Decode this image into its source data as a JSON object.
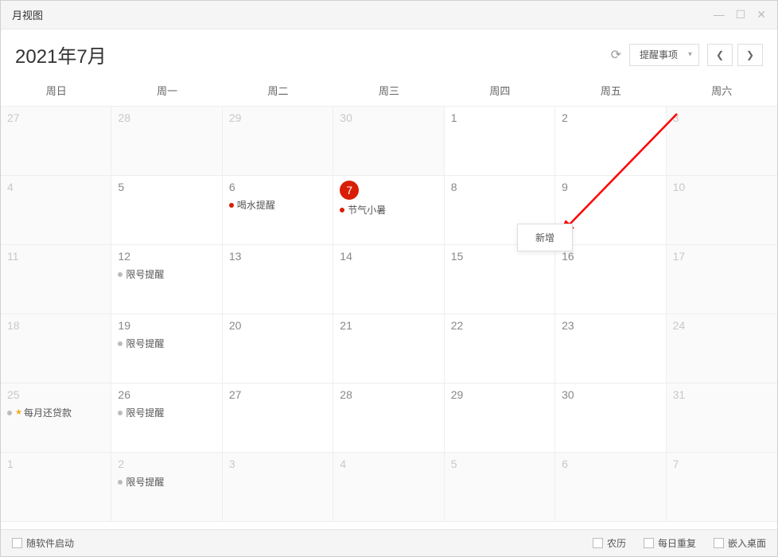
{
  "window": {
    "title": "月视图"
  },
  "header": {
    "month": "2021年7月",
    "filter": "提醒事项"
  },
  "weekdays": [
    "周日",
    "周一",
    "周二",
    "周三",
    "周四",
    "周五",
    "周六"
  ],
  "cells": [
    {
      "n": "27",
      "out": true,
      "events": []
    },
    {
      "n": "28",
      "out": true,
      "events": []
    },
    {
      "n": "29",
      "out": true,
      "events": []
    },
    {
      "n": "30",
      "out": true,
      "events": []
    },
    {
      "n": "1",
      "events": []
    },
    {
      "n": "2",
      "events": []
    },
    {
      "n": "3",
      "out": true,
      "events": []
    },
    {
      "n": "4",
      "out": true,
      "events": []
    },
    {
      "n": "5",
      "events": []
    },
    {
      "n": "6",
      "events": [
        {
          "dot": "red",
          "label": "喝水提醒"
        }
      ]
    },
    {
      "n": "7",
      "today": true,
      "events": [
        {
          "dot": "red",
          "label": "节气小暑"
        }
      ]
    },
    {
      "n": "8",
      "events": []
    },
    {
      "n": "9",
      "events": []
    },
    {
      "n": "10",
      "out": true,
      "events": []
    },
    {
      "n": "11",
      "out": true,
      "events": []
    },
    {
      "n": "12",
      "events": [
        {
          "dot": "gray",
          "label": "限号提醒"
        }
      ]
    },
    {
      "n": "13",
      "events": []
    },
    {
      "n": "14",
      "events": []
    },
    {
      "n": "15",
      "events": []
    },
    {
      "n": "16",
      "events": []
    },
    {
      "n": "17",
      "out": true,
      "events": []
    },
    {
      "n": "18",
      "out": true,
      "events": []
    },
    {
      "n": "19",
      "events": [
        {
          "dot": "gray",
          "label": "限号提醒"
        }
      ]
    },
    {
      "n": "20",
      "events": []
    },
    {
      "n": "21",
      "events": []
    },
    {
      "n": "22",
      "events": []
    },
    {
      "n": "23",
      "events": []
    },
    {
      "n": "24",
      "out": true,
      "events": []
    },
    {
      "n": "25",
      "out": true,
      "events": [
        {
          "dot": "gray",
          "star": true,
          "label": "每月还贷款"
        }
      ]
    },
    {
      "n": "26",
      "events": [
        {
          "dot": "gray",
          "label": "限号提醒"
        }
      ]
    },
    {
      "n": "27",
      "events": []
    },
    {
      "n": "28",
      "events": []
    },
    {
      "n": "29",
      "events": []
    },
    {
      "n": "30",
      "events": []
    },
    {
      "n": "31",
      "out": true,
      "events": []
    },
    {
      "n": "1",
      "out": true,
      "events": []
    },
    {
      "n": "2",
      "out": true,
      "events": [
        {
          "dot": "gray",
          "label": "限号提醒"
        }
      ]
    },
    {
      "n": "3",
      "out": true,
      "events": []
    },
    {
      "n": "4",
      "out": true,
      "events": []
    },
    {
      "n": "5",
      "out": true,
      "events": []
    },
    {
      "n": "6",
      "out": true,
      "events": []
    },
    {
      "n": "7",
      "out": true,
      "events": []
    }
  ],
  "popup": {
    "label": "新增"
  },
  "footer": {
    "left": "随软件启动",
    "right": [
      "农历",
      "每日重复",
      "嵌入桌面"
    ]
  }
}
